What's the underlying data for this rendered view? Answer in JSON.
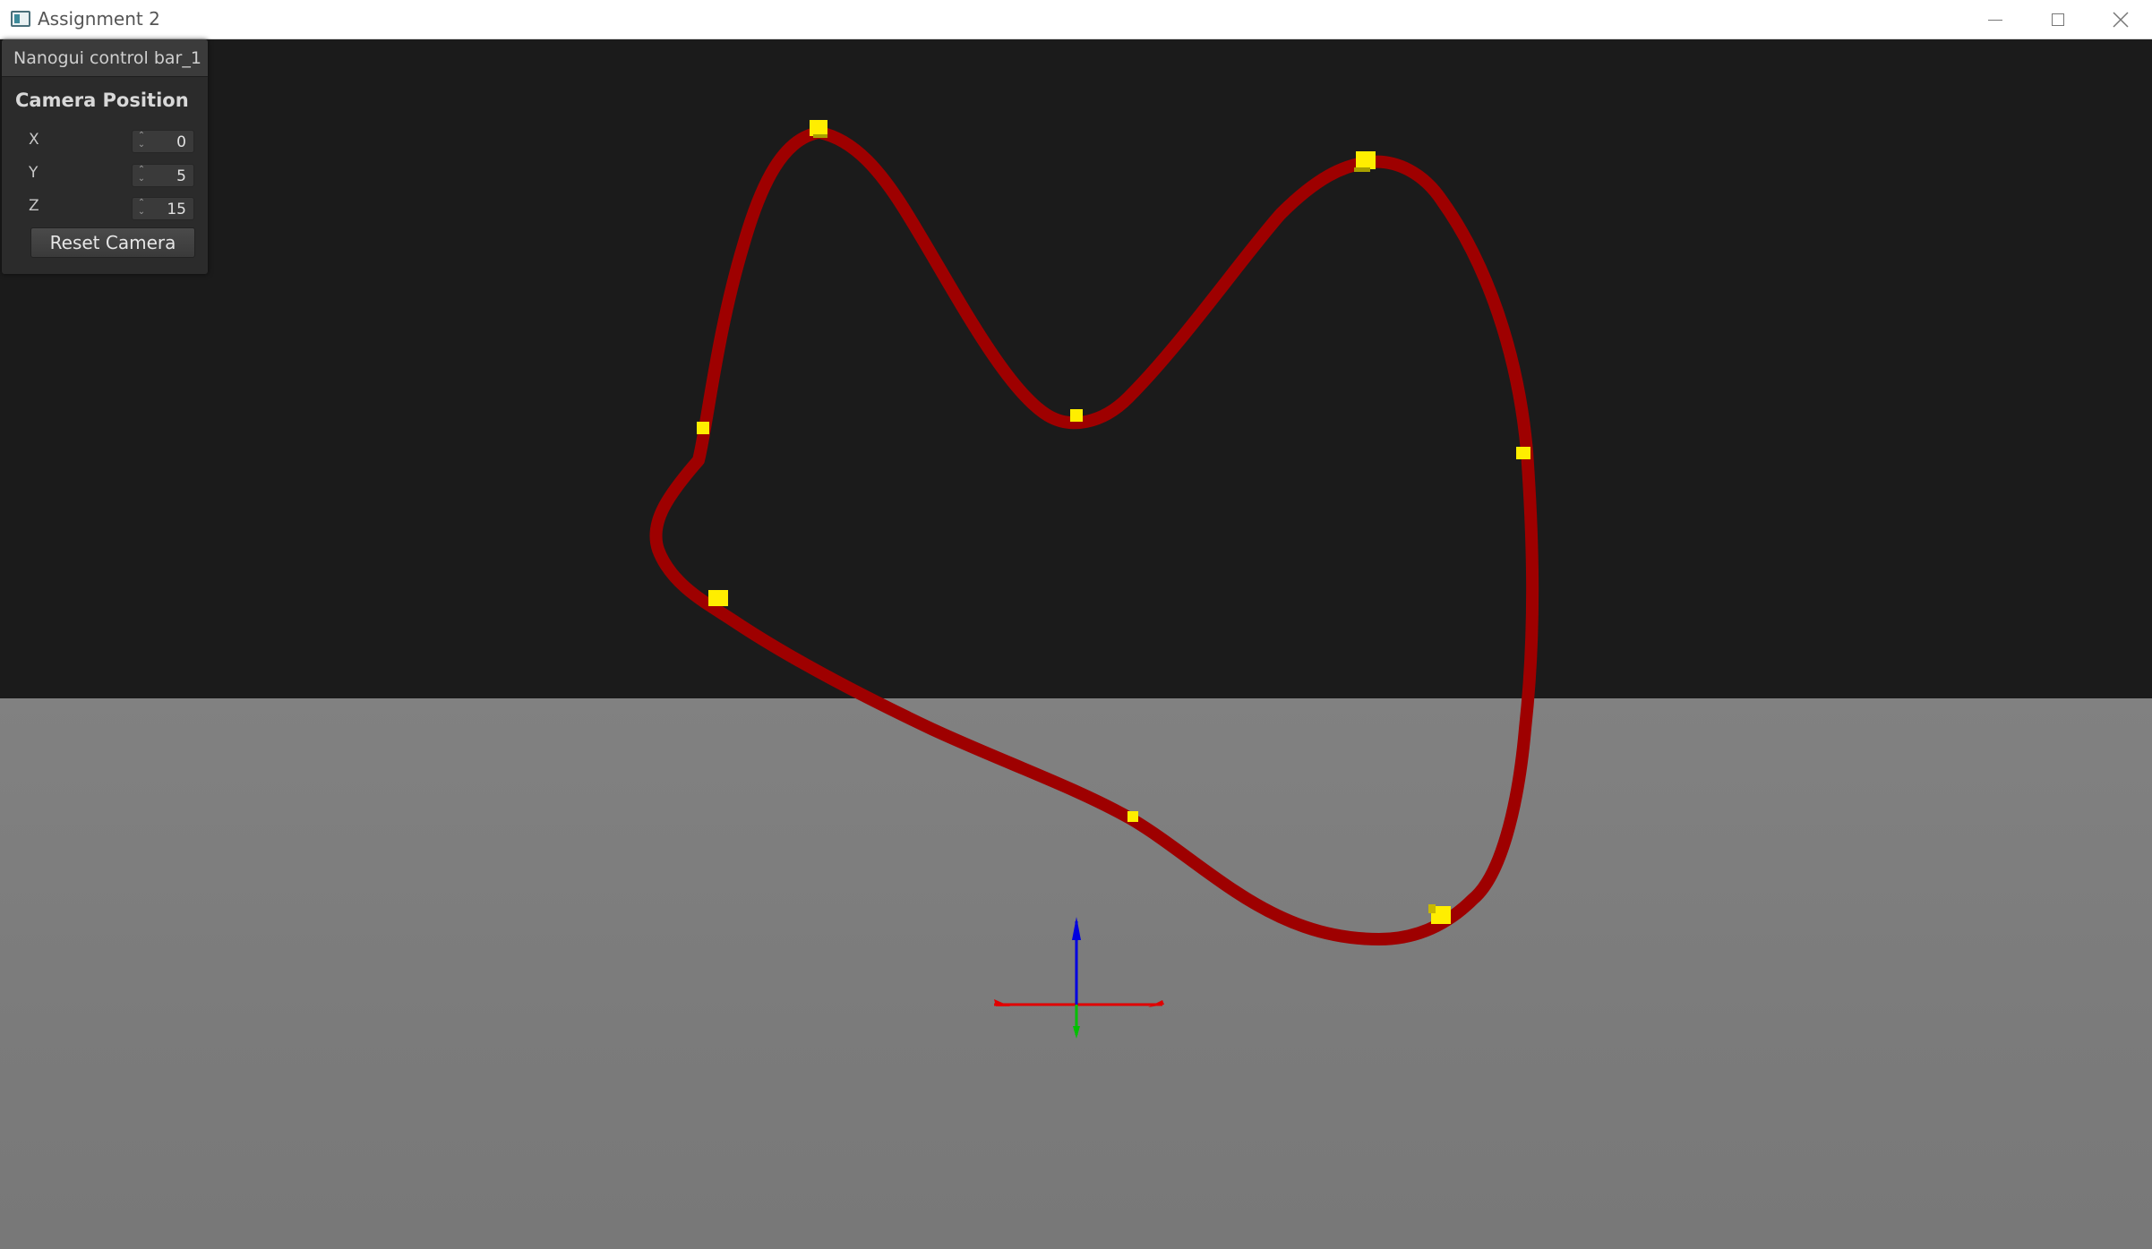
{
  "window": {
    "title": "Assignment 2",
    "controls": {
      "minimize_icon": "minimize-icon",
      "maximize_icon": "maximize-icon",
      "close_icon": "close-icon"
    }
  },
  "panel": {
    "title": "Nanogui control bar_1",
    "group_label": "Camera Position",
    "fields": [
      {
        "label": "X",
        "value": "0"
      },
      {
        "label": "Y",
        "value": "5"
      },
      {
        "label": "Z",
        "value": "15"
      }
    ],
    "reset_label": "Reset Camera"
  },
  "scene": {
    "colors": {
      "sky": "#1b1b1b",
      "ground": "#7d7d7d",
      "curve": "#9e0000",
      "control_point": "#ffee00",
      "axis_x": "#e00000",
      "axis_y": "#0000e0",
      "axis_z": "#00c000"
    }
  }
}
